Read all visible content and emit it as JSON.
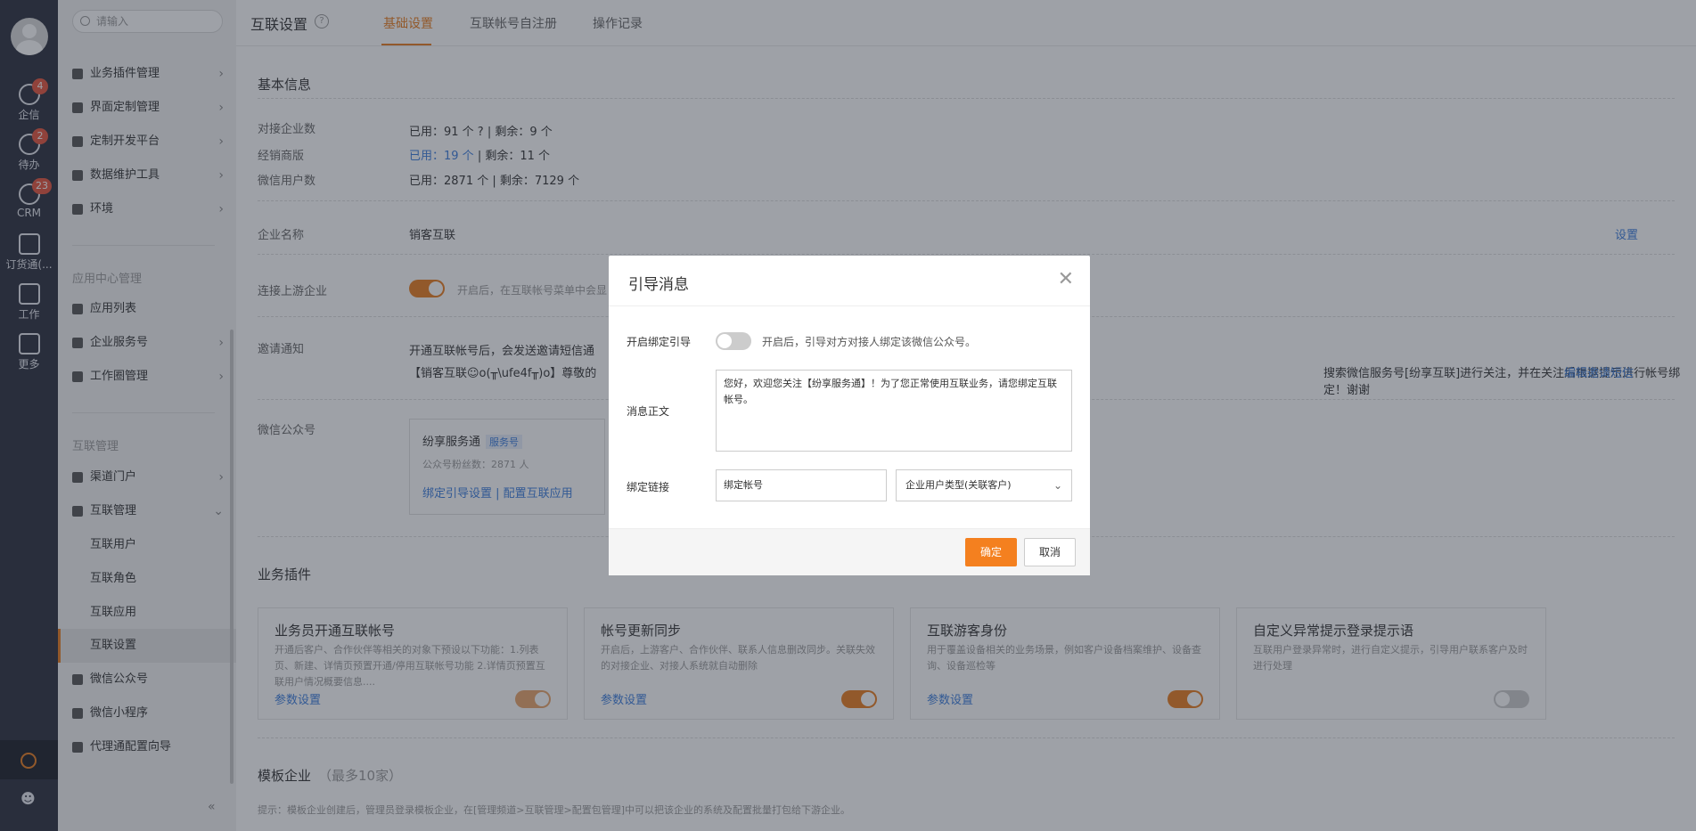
{
  "rail": {
    "items": [
      {
        "label": "企信",
        "badge": "4",
        "icon": "chat-icon"
      },
      {
        "label": "待办",
        "badge": "2",
        "icon": "check-icon"
      },
      {
        "label": "CRM",
        "badge": "23",
        "icon": "clock-icon"
      },
      {
        "label": "订货通(...",
        "badge": "",
        "icon": "order-icon"
      },
      {
        "label": "工作",
        "badge": "",
        "icon": "briefcase-icon"
      },
      {
        "label": "更多",
        "badge": "",
        "icon": "grid-icon"
      }
    ]
  },
  "sidebar": {
    "search_placeholder": "请输入",
    "items_top": [
      {
        "label": "业务插件管理"
      },
      {
        "label": "界面定制管理"
      },
      {
        "label": "定制开发平台"
      },
      {
        "label": "数据维护工具"
      },
      {
        "label": "环境"
      }
    ],
    "section_app": "应用中心管理",
    "items_app": [
      {
        "label": "应用列表"
      },
      {
        "label": "企业服务号"
      },
      {
        "label": "工作圈管理"
      }
    ],
    "section_interconnect": "互联管理",
    "items_interconnect": [
      {
        "label": "渠道门户"
      },
      {
        "label": "互联管理"
      }
    ],
    "sub_items": [
      {
        "label": "互联用户"
      },
      {
        "label": "互联角色"
      },
      {
        "label": "互联应用"
      },
      {
        "label": "互联设置"
      }
    ],
    "items_bottom": [
      {
        "label": "微信公众号"
      },
      {
        "label": "微信小程序"
      },
      {
        "label": "代理通配置向导"
      }
    ]
  },
  "header": {
    "title": "互联设置",
    "tabs": [
      {
        "label": "基础设置"
      },
      {
        "label": "互联帐号自注册"
      },
      {
        "label": "操作记录"
      }
    ]
  },
  "basic": {
    "section_title": "基本信息",
    "rows": [
      {
        "label": "对接企业数",
        "value": "已用：91 个 ? | 剩余：9 个"
      },
      {
        "label": "经销商版",
        "value_used": "已用：19 个",
        "value_rest": " | 剩余：11 个"
      },
      {
        "label": "微信用户数",
        "value": "已用：2871 个 | 剩余：7129 个"
      }
    ],
    "company_label": "企业名称",
    "company_value": "销客互联",
    "company_action": "设置",
    "upstream_label": "连接上游企业",
    "upstream_note": "开启后，在互联帐号菜单中会显",
    "invite_label": "邀请通知",
    "invite_line1": "开通互联帐号后，会发送邀请短信通",
    "invite_line2_left": "【销客互联☺o(╥\\ufe4f╥)o】尊敬的",
    "invite_line2_right": "搜索微信服务号[纷享互联]进行关注，并在关注后根据提示进行帐号绑定！谢谢",
    "invite_action": "编辑邀请短信",
    "wechat_label": "微信公众号",
    "wechat_card": {
      "name": "纷享服务通",
      "tag": "服务号",
      "fans": "公众号粉丝数：2871 人",
      "links": "绑定引导设置 | 配置互联应用"
    }
  },
  "plugins": {
    "section_title": "业务插件",
    "cards": [
      {
        "title": "业务员开通互联帐号",
        "desc": "开通后客户、合作伙伴等相关的对象下预设以下功能：1.列表页、新建、详情页预置开通/停用互联帐号功能 2.详情页预置互联用户情况概要信息....",
        "link": "参数设置",
        "enabled": true
      },
      {
        "title": "帐号更新同步",
        "desc": "开启后，上游客户、合作伙伴、联系人信息删改同步。关联失效的对接企业、对接人系统就自动删除",
        "link": "参数设置",
        "enabled": true
      },
      {
        "title": "互联游客身份",
        "desc": "用于覆盖设备相关的业务场景，例如客户设备档案维护、设备查询、设备巡检等",
        "link": "参数设置",
        "enabled": true
      },
      {
        "title": "自定义异常提示登录提示语",
        "desc": "互联用户登录异常时，进行自定义提示，引导用户联系客户及时进行处理",
        "link": "",
        "enabled": false
      }
    ]
  },
  "template": {
    "section_title": "模板企业",
    "section_sub": "（最多10家）",
    "hint": "提示：模板企业创建后，管理员登录模板企业，在[管理频道>互联管理>配置包管理]中可以把该企业的系统及配置批量打包给下游企业。"
  },
  "modal": {
    "title": "引导消息",
    "bind_guide_label": "开启绑定引导",
    "bind_guide_note": "开启后，引导对方对接人绑定该微信公众号。",
    "bind_guide_enabled": false,
    "body_label": "消息正文",
    "body_value": "您好，欢迎您关注【纷享服务通】！为了您正常使用互联业务，请您绑定互联帐号。",
    "link_label": "绑定链接",
    "link_value": "绑定帐号",
    "link_type": "企业用户类型(关联客户)",
    "ok_label": "确定",
    "cancel_label": "取消"
  },
  "colors": {
    "accent": "#e97d1e",
    "link": "#3b7ddd",
    "badge": "#e5533b"
  }
}
